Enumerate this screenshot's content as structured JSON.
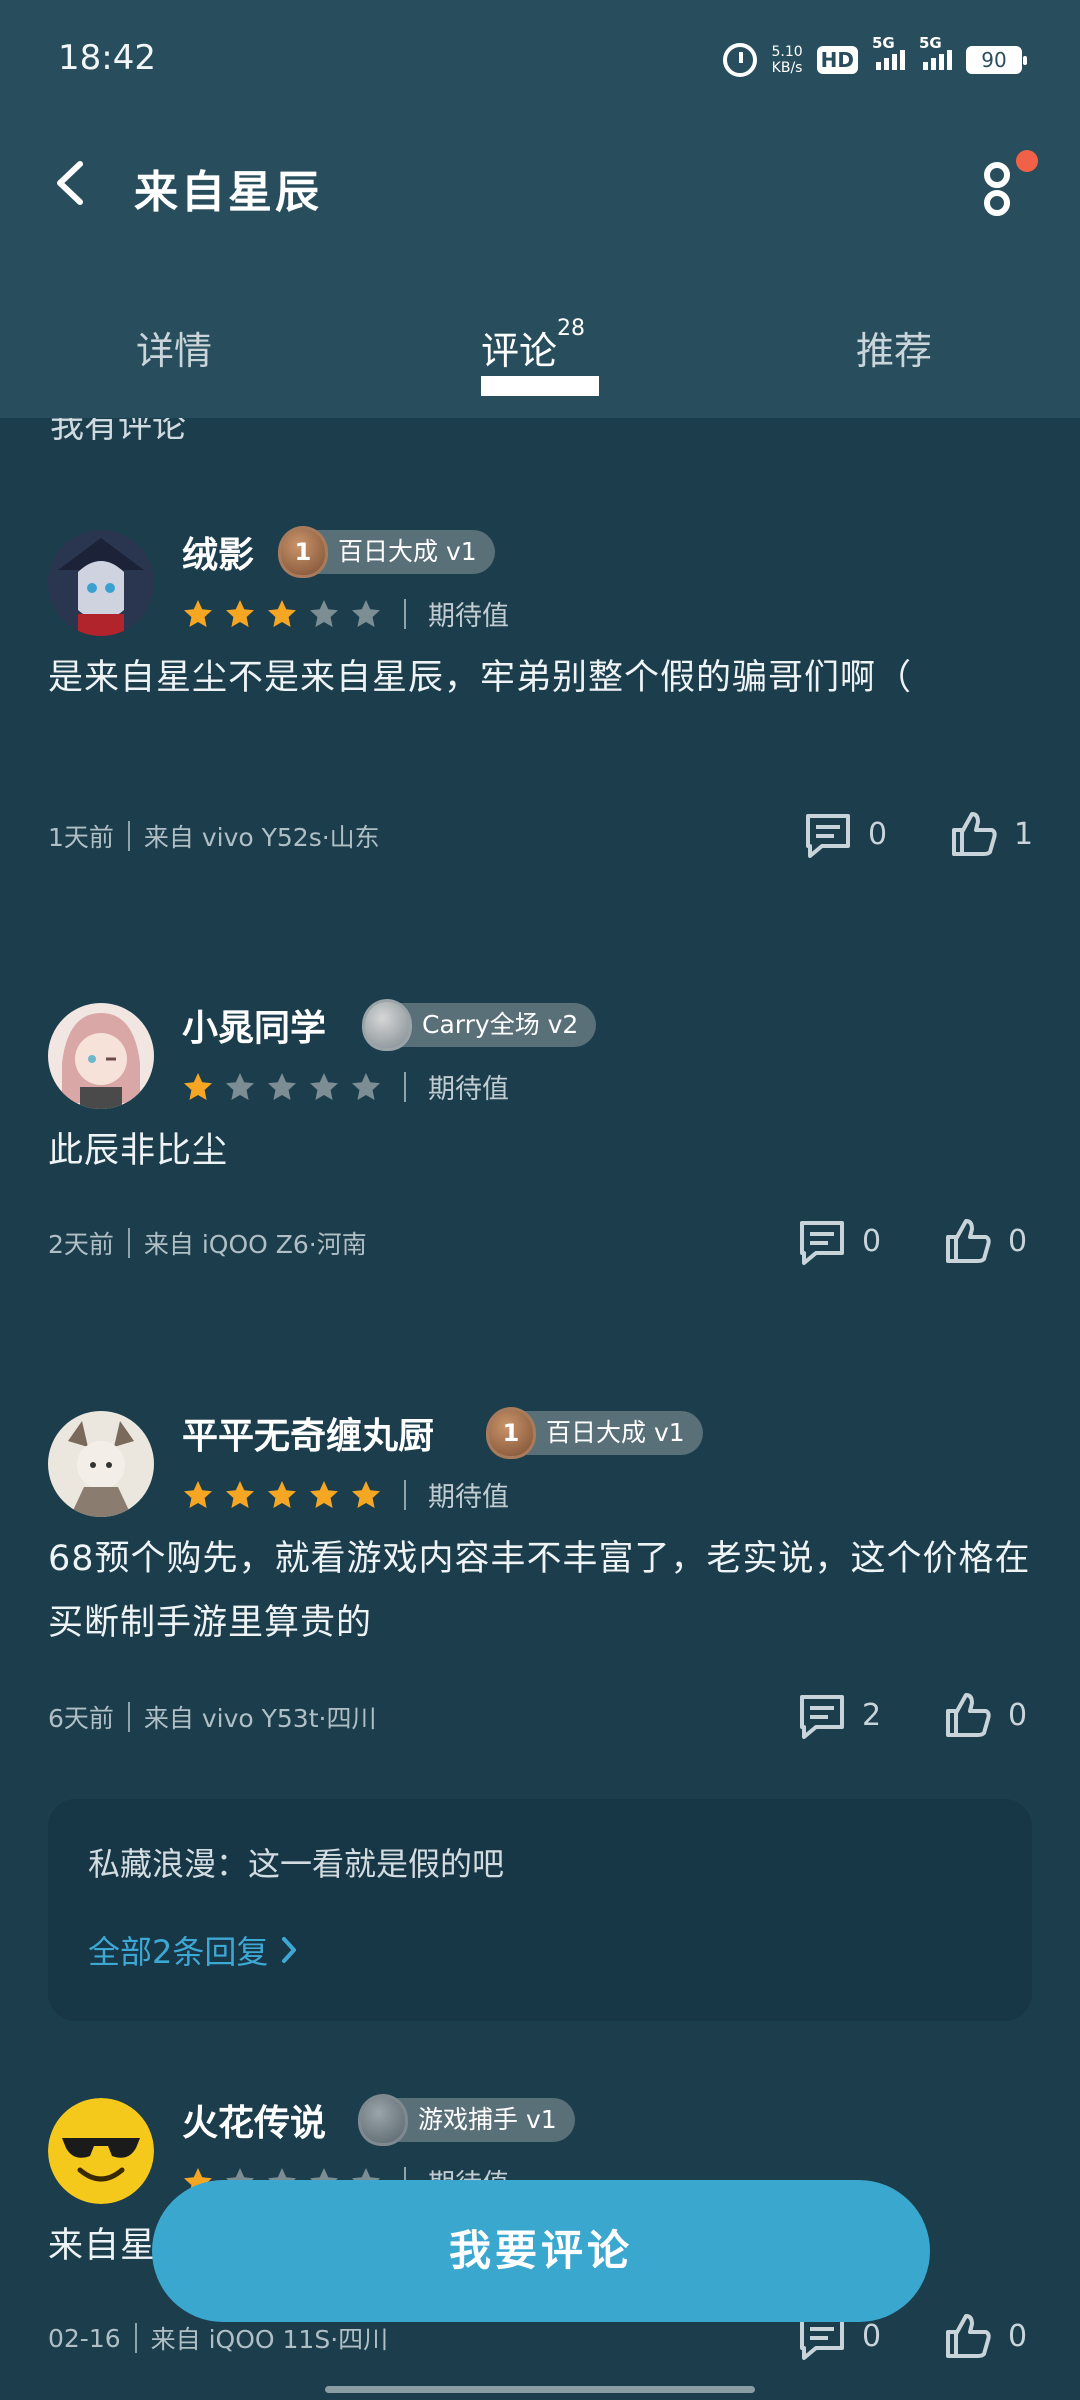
{
  "status": {
    "time": "18:42",
    "speed_value": "5.10",
    "speed_unit": "KB/s",
    "hd": "HD",
    "sim": "1\n2",
    "net1": "5G",
    "net2": "5G",
    "battery": "90"
  },
  "header": {
    "title": "来自星辰"
  },
  "tabs": [
    {
      "label": "详情"
    },
    {
      "label": "评论",
      "count": "28"
    },
    {
      "label": "推荐"
    }
  ],
  "partial_text": "我有评论",
  "colors": {
    "accent": "#3aa7cf",
    "star_on": "#f5a623",
    "star_off": "#7c8d94",
    "badge_dot": "#f06148"
  },
  "comments": [
    {
      "name": "绒影",
      "badge": "百日大成 v1",
      "medal": "1",
      "stars": 3,
      "expect_label": "期待值",
      "text": "是来自星尘不是来自星辰，牢弟别整个假的骗哥们啊（",
      "time": "1天前",
      "device": "来自 vivo Y52s·山东",
      "replies": "0",
      "likes": "1"
    },
    {
      "name": "小晁同学",
      "badge": "Carry全场 v2",
      "medal": "",
      "stars": 1,
      "expect_label": "期待值",
      "text": "此辰非比尘",
      "time": "2天前",
      "device": "来自 iQOO Z6·河南",
      "replies": "0",
      "likes": "0"
    },
    {
      "name": "平平无奇缠丸厨",
      "badge": "百日大成 v1",
      "medal": "1",
      "stars": 5,
      "expect_label": "期待值",
      "text": "68预个购先，就看游戏内容丰不丰富了，老实说，这个价格在买断制手游里算贵的",
      "time": "6天前",
      "device": "来自 vivo Y53t·四川",
      "replies": "2",
      "likes": "0",
      "reply_preview": "私藏浪漫：这一看就是假的吧",
      "reply_link": "全部2条回复"
    },
    {
      "name": "火花传说",
      "badge": "游戏捕手 v1",
      "medal": "",
      "stars": 1,
      "expect_label": "期待值",
      "text": "来自星",
      "time": "02-16",
      "device": "来自 iQOO 11S·四川",
      "replies": "0",
      "likes": "0"
    }
  ],
  "cta": {
    "label": "我要评论"
  }
}
